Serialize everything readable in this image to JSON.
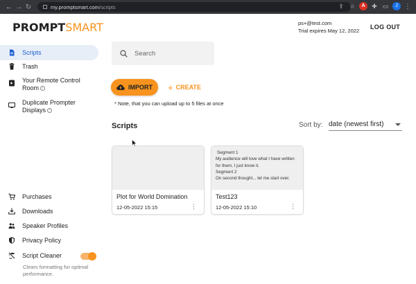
{
  "browser": {
    "url_domain": "my.promptsmart.com",
    "url_path": "/scripts"
  },
  "header": {
    "logo_part1": "PROMPT",
    "logo_part2": "SMART",
    "email": "ps+@test.com",
    "trial": "Trial expires May 12, 2022",
    "logout_label": "LOG OUT"
  },
  "sidebar": {
    "items": [
      {
        "label": "Scripts",
        "icon": "document-icon"
      },
      {
        "label": "Trash",
        "icon": "trash-icon"
      },
      {
        "label": "Your Remote Control Room",
        "icon": "remote-icon"
      },
      {
        "label": "Duplicate Prompter Displays",
        "icon": "monitor-icon"
      }
    ],
    "bottom_items": [
      {
        "label": "Purchases",
        "icon": "cart-icon"
      },
      {
        "label": "Downloads",
        "icon": "download-icon"
      },
      {
        "label": "Speaker Profiles",
        "icon": "people-icon"
      },
      {
        "label": "Privacy Policy",
        "icon": "shield-icon"
      },
      {
        "label": "Script Cleaner",
        "icon": "cleaner-icon"
      }
    ],
    "cleaner_description": "Clears formatting for optimal performance."
  },
  "search": {
    "placeholder": "Search"
  },
  "actions": {
    "import_label": "IMPORT",
    "create_label": "CREATE",
    "note": "* Note, that you can upload up to 5 files at once"
  },
  "scripts": {
    "title": "Scripts",
    "sort_label": "Sort by:",
    "sort_value": "date (newest first)",
    "cards": [
      {
        "title": "Plot for World Domination",
        "date": "12-05-2022 15:15",
        "preview": []
      },
      {
        "title": "Test123",
        "date": "12-05-2022 15:10",
        "preview": [
          "Segment 1",
          "My audience will love what I have written for them, I just know it.",
          "Segment 2",
          "On second thought... let me start over."
        ]
      }
    ]
  },
  "colors": {
    "accent": "#f7931e",
    "active_bg": "#e8eef8",
    "active_text": "#1a5fd0"
  }
}
